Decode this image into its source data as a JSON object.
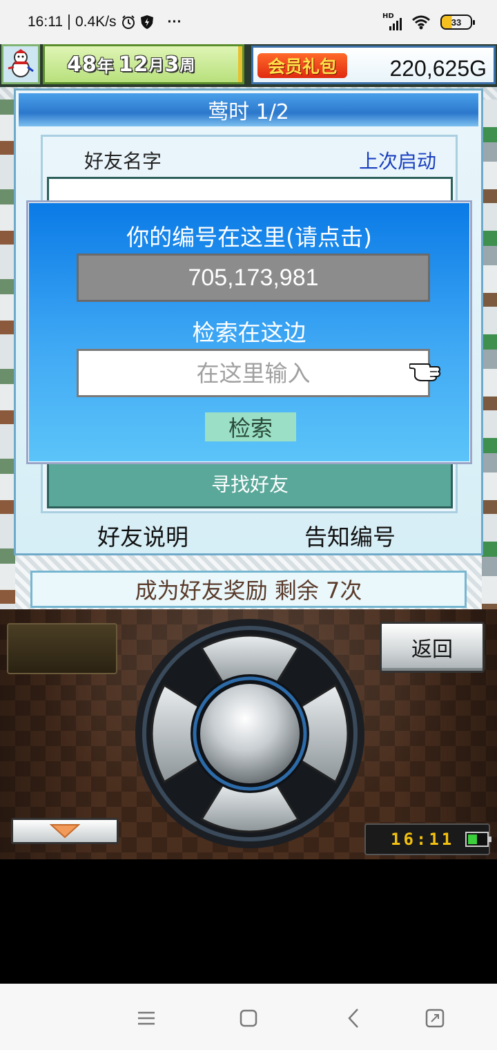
{
  "status_bar": {
    "time": "16:11",
    "net_speed": "0.4K/s",
    "signal_label": "HD",
    "battery_level": "33",
    "more": "···"
  },
  "top_bar": {
    "date": {
      "year_num": "48",
      "year_unit": "年",
      "month_num": "12",
      "month_unit": "月",
      "week_num": "3",
      "week_unit": "周"
    },
    "member_pack": "会员礼包",
    "money": "220,625G"
  },
  "friend_panel": {
    "title": "莺时 1/2",
    "col_name": "好友名字",
    "col_last_launch": "上次启动",
    "find_friend": "寻找好友",
    "friend_help": "好友说明",
    "notify_id": "告知编号"
  },
  "id_dialog": {
    "title": "你的编号在这里(请点击)",
    "id_number": "705,173,981",
    "search_label": "检索在这边",
    "search_placeholder": "在这里输入",
    "search_button": "检索"
  },
  "reward_bar": "成为好友奖励 剩余 7次",
  "controller": {
    "back_button": "返回",
    "clock": "16:11"
  },
  "colors": {
    "dialog_blue": "#0a7ae6",
    "friend_button": "#5aa89a",
    "search_button": "#9be0c6",
    "member_badge": "#e02a10"
  }
}
